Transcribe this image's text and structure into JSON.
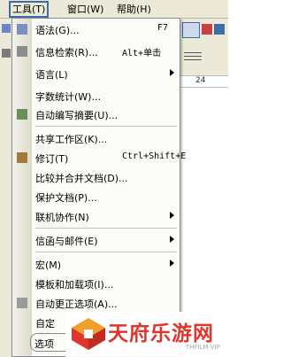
{
  "menubar": {
    "tools": "工具(T)",
    "window": "窗口(W)",
    "help": "帮助(H)"
  },
  "ruler": {
    "tick": "24"
  },
  "menu": {
    "grammar": {
      "label": "语法(G)...",
      "shortcut": "F7"
    },
    "research": {
      "label": "信息检索(R)...",
      "shortcut": "Alt+单击"
    },
    "language": {
      "label": "语言(L)"
    },
    "word_count": {
      "label": "字数统计(W)..."
    },
    "autosummarize": {
      "label": "自动编写摘要(U)..."
    },
    "shared_workspace": {
      "label": "共享工作区(K)..."
    },
    "track_changes": {
      "label": "修订(T)",
      "shortcut": "Ctrl+Shift+E"
    },
    "compare_merge": {
      "label": "比较并合并文档(D)..."
    },
    "protect": {
      "label": "保护文档(P)..."
    },
    "online_collab": {
      "label": "联机协作(N)"
    },
    "letters_mailings": {
      "label": "信函与邮件(E)"
    },
    "macro": {
      "label": "宏(M)"
    },
    "templates_addins": {
      "label": "模板和加载项(I)..."
    },
    "autocorrect": {
      "label": "自动更正选项(A)..."
    },
    "custom": {
      "label": "自定"
    },
    "options": {
      "label": "选项"
    }
  },
  "watermark": {
    "name": "天府乐游网",
    "sub": "THFILM VIP"
  },
  "colors": {
    "menubar_bg": "#ece9d8",
    "menu_bg": "#fbfbf8",
    "watermark_red": "#e0352b",
    "active_border": "#3a6ea5"
  }
}
